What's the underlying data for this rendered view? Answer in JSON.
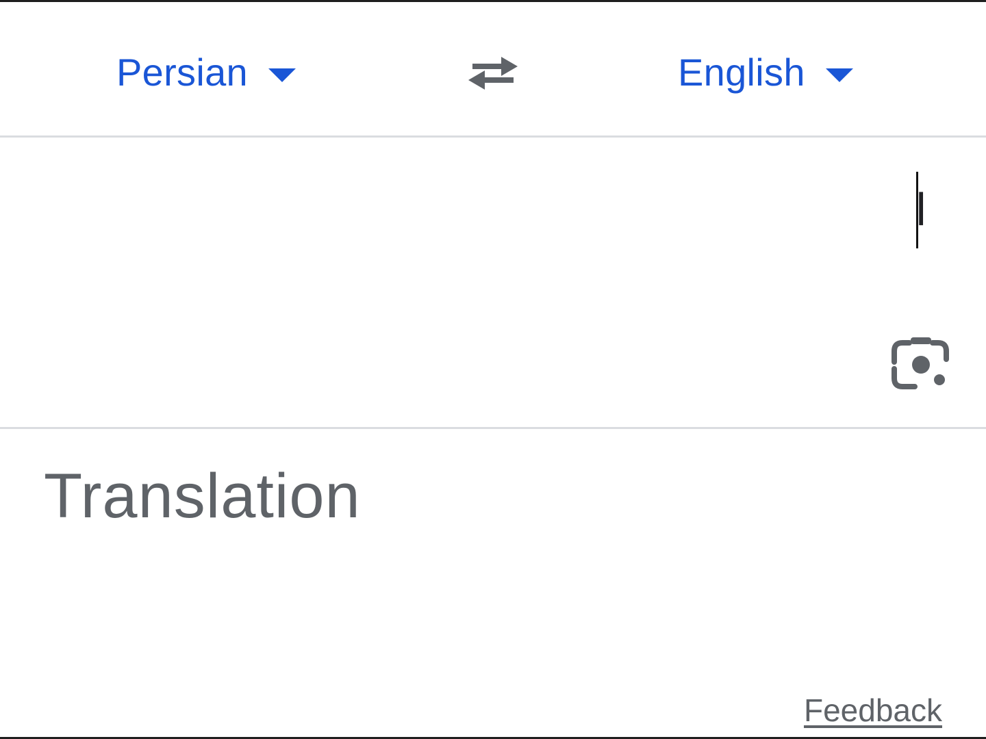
{
  "language_bar": {
    "source_language": "Persian",
    "target_language": "English",
    "swap_icon": "swap-arrows-icon",
    "caret_icon": "caret-down-icon",
    "accent_color": "#1a56d6"
  },
  "input": {
    "text": "ا",
    "camera_icon": "camera-lens-icon"
  },
  "output": {
    "placeholder": "Translation",
    "feedback_label": "Feedback"
  }
}
